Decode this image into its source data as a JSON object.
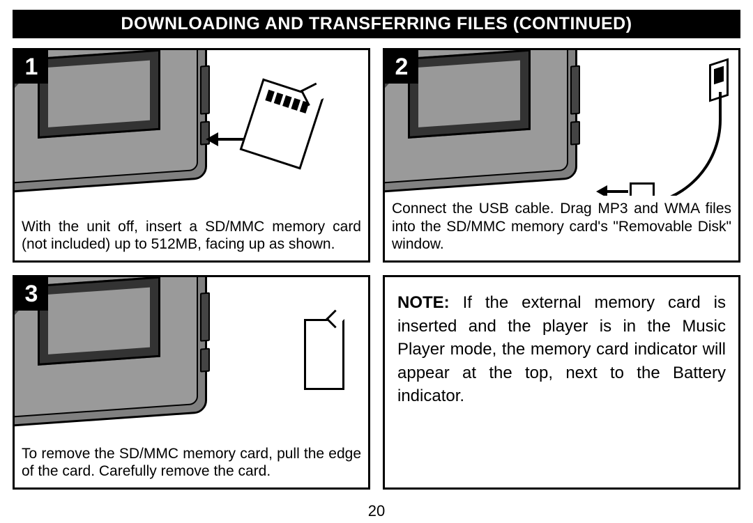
{
  "title": "DOWNLOADING AND TRANSFERRING FILES (CONTINUED)",
  "page_number": "20",
  "steps": {
    "s1": {
      "num": "1",
      "caption": "With the unit off, insert a SD/MMC memory card (not included) up to 512MB, facing up as shown."
    },
    "s2": {
      "num": "2",
      "caption": "Connect the USB cable. Drag MP3 and WMA files into the SD/MMC memory card's \"Removable Disk\" window."
    },
    "s3": {
      "num": "3",
      "caption": "To remove the SD/MMC memory card, pull the edge of the card. Carefully remove the card."
    }
  },
  "note": {
    "label": "NOTE:",
    "body": " If the external memory card is inserted and the player is in the Music Player mode, the memory card indicator will appear at the top, next to the Battery indicator."
  }
}
